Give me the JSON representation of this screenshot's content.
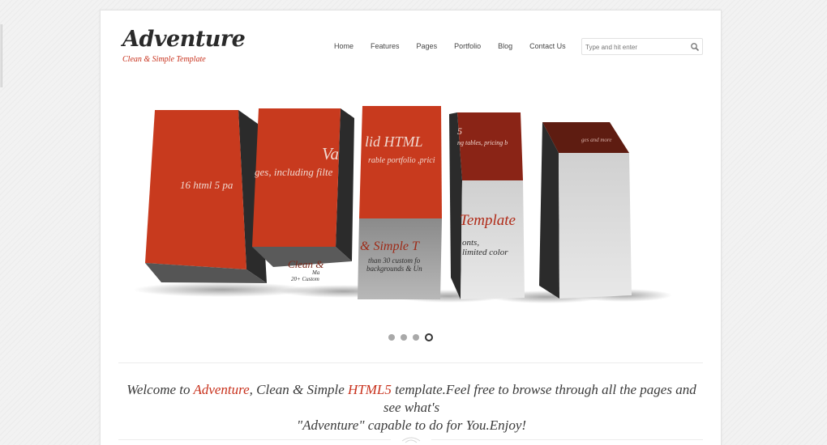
{
  "logo": {
    "title": "Adventure",
    "tagline": "Clean & Simple Template"
  },
  "nav": [
    "Home",
    "Features",
    "Pages",
    "Portfolio",
    "Blog",
    "Contact Us"
  ],
  "search": {
    "placeholder": "Type and hit enter",
    "icon": "search-icon"
  },
  "slider": {
    "fragments": {
      "pages": "16 html 5 pa",
      "pages2": "ges, including filte",
      "valid": "Va",
      "valid2": "lid HTML",
      "five": "5",
      "portfolio": "rable portfolio ,prici",
      "pricing": "ng tables, pricing b",
      "more": "ges and more",
      "template": "Template",
      "clean": "Clean &",
      "simple": "& Simple T",
      "fonts1": "than 30 custom fo",
      "fonts2": "backgrounds & Un",
      "fonts3": "onts,",
      "fonts4": "limited color",
      "custom1": "Ma",
      "custom2": "20+ Custom"
    },
    "dots": 4,
    "active_dot": 4
  },
  "welcome": {
    "part1": "Welcome to ",
    "brand": "Adventure",
    "part2": ", Clean & Simple ",
    "html5": "HTML5",
    "part3": " template.Feel free to browse through all the pages and see what's",
    "line2": "\"Adventure\" capable to do for You.Enjoy!"
  },
  "colors": {
    "accent": "#c8311c",
    "dark": "#2a2a2a",
    "grey_face": "#8c8c8c"
  }
}
